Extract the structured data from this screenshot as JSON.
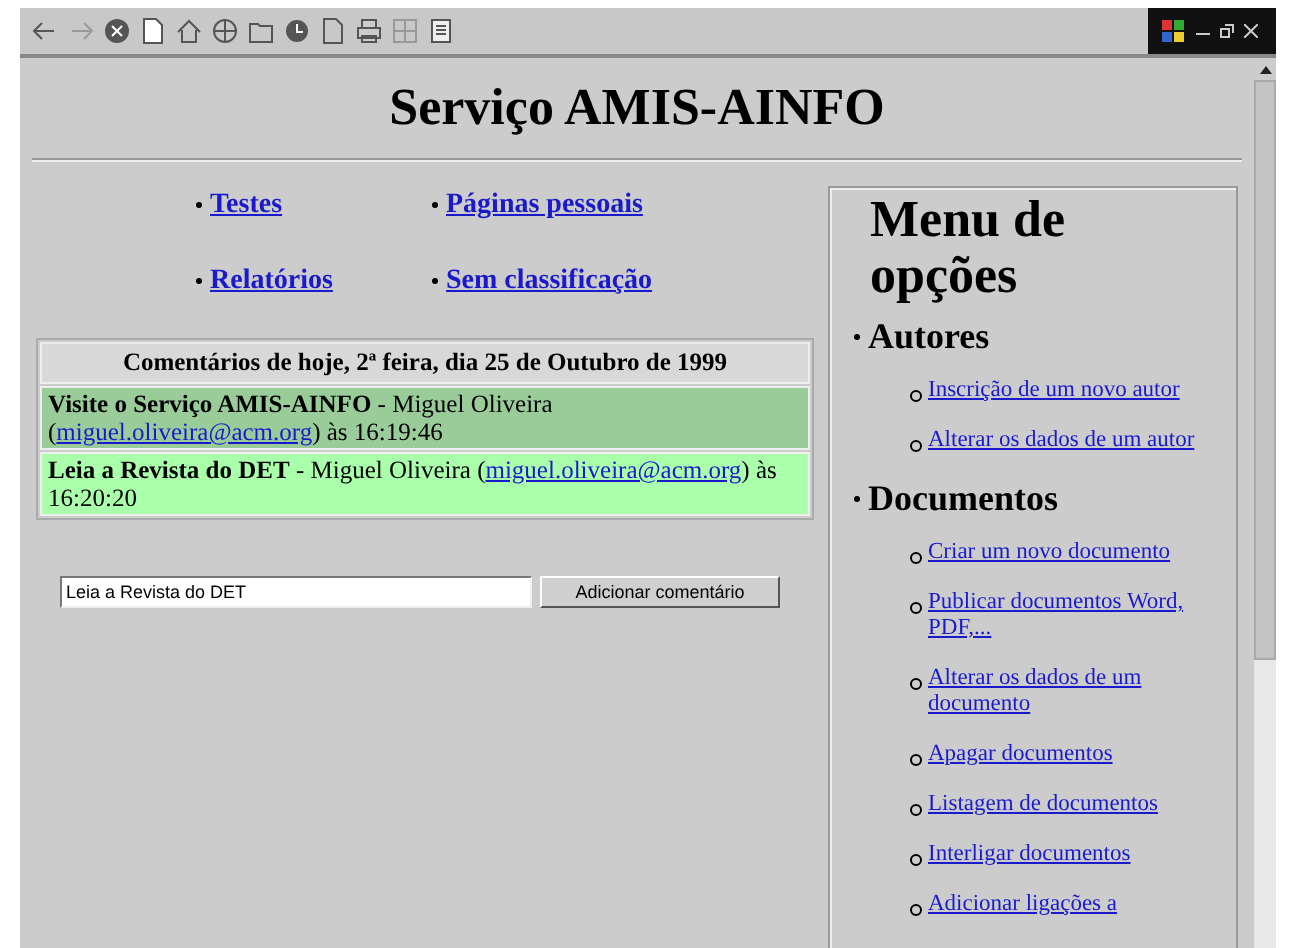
{
  "page": {
    "title": "Serviço AMIS-AINFO",
    "categories": [
      {
        "label": "Testes"
      },
      {
        "label": "Páginas pessoais"
      },
      {
        "label": "Relatórios"
      },
      {
        "label": "Sem classificação"
      }
    ],
    "comments": {
      "header": "Comentários de hoje, 2ª feira, dia 25 de Outubro de 1999",
      "items": [
        {
          "before": "**Visite o Serviço AMIS-AINFO** - Miguel Oliveira (",
          "email": "miguel.oliveira@acm.org",
          "after": ") às 16:19:46",
          "color": "#99cc99"
        },
        {
          "before": "**Leia a Revista do DET** - Miguel Oliveira (",
          "email": "miguel.oliveira@acm.org",
          "after": ") às 16:20:20",
          "color": "#aaffaa"
        }
      ]
    },
    "comment_form": {
      "value": "Leia a Revista do DET",
      "button": "Adicionar comentário"
    }
  },
  "menu": {
    "title": "Menu de opções",
    "sections": [
      {
        "label": "Autores",
        "children": [
          {
            "label": "Inscrição de um novo autor"
          },
          {
            "label": "Alterar os dados de um autor"
          }
        ]
      },
      {
        "label": "Documentos",
        "children": [
          {
            "label": "Criar um novo documento"
          },
          {
            "label": "Publicar documentos Word, PDF,..."
          },
          {
            "label": "Alterar os dados de um documento"
          },
          {
            "label": "Apagar documentos"
          },
          {
            "label": "Listagem de documentos"
          },
          {
            "label": "Interligar documentos"
          },
          {
            "label": "Adicionar ligações a"
          }
        ]
      }
    ]
  }
}
